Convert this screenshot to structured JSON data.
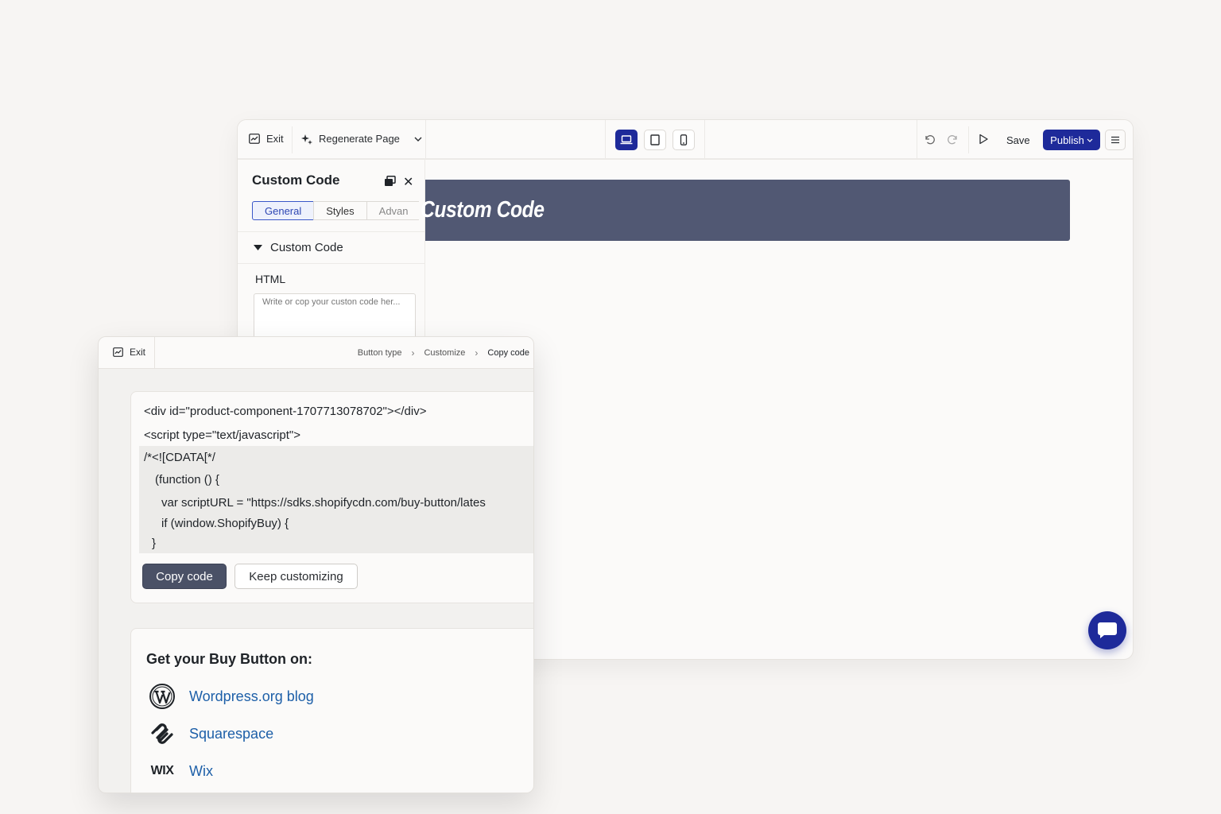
{
  "builder": {
    "exit_label": "Exit",
    "regenerate_label": "Regenerate Page",
    "save_label": "Save",
    "publish_label": "Publish",
    "panel": {
      "title": "Custom Code",
      "tabs": [
        "General",
        "Styles",
        "Advan"
      ],
      "section_label": "Custom Code",
      "html_label": "HTML",
      "textarea_placeholder": "Write or cop your custon code her..."
    },
    "banner_text": "Custom Code",
    "accent_color": "#1e2a9a"
  },
  "buy_button": {
    "exit_label": "Exit",
    "breadcrumb": [
      "Button type",
      "Customize",
      "Copy code"
    ],
    "code_lines": [
      "<div id=\"product-component-1707713078702\"></div>",
      "<script type=\"text/javascript\">",
      "/*<![CDATA[*/",
      "(function () {",
      "var scriptURL = \"https://sdks.shopifycdn.com/buy-button/lates",
      "if (window.ShopifyBuy) {",
      "}"
    ],
    "copy_button": "Copy code",
    "keep_button": "Keep customizing",
    "platforms_heading": "Get your Buy Button on:",
    "platforms": [
      {
        "name": "Wordpress.org blog",
        "icon": "wordpress-icon"
      },
      {
        "name": "Squarespace",
        "icon": "squarespace-icon"
      },
      {
        "name": "Wix",
        "icon": "wix-logo",
        "logo_text": "WIX"
      }
    ]
  }
}
